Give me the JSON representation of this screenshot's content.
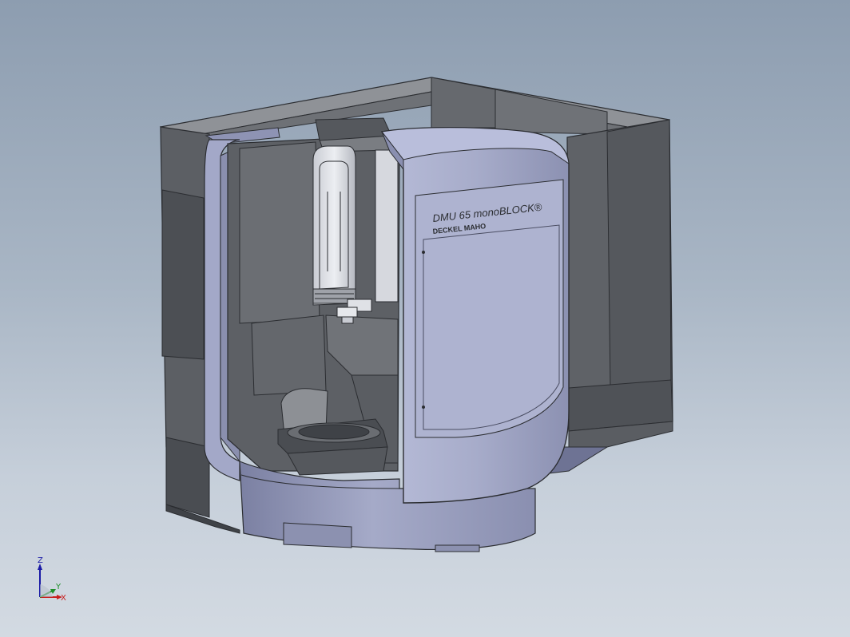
{
  "viewport": {
    "background_top": "#8d9db0",
    "background_bottom": "#d3dae2"
  },
  "model": {
    "brand_text": "DMU 65 monoBLOCK®",
    "maker_text": "DECKEL MAHO",
    "colors": {
      "enclosure_dark": "#5b5e63",
      "enclosure_top": "#8e9196",
      "door_panel": "#a3a8c8",
      "door_edge": "#7f84a8",
      "base_ring": "#9aa0c0",
      "interior": "#6a6d72",
      "spindle": "#d9dbe0"
    }
  },
  "triad": {
    "z_label": "Z",
    "y_label": "Y",
    "x_label": "X",
    "z_color": "#1a1aa6",
    "x_color": "#c81e1e",
    "y_color": "#1e8f2a"
  }
}
